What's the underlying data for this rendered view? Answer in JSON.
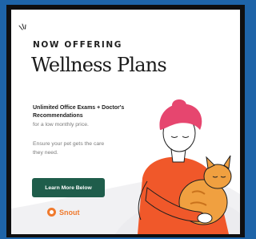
{
  "ad": {
    "kicker": "NOW OFFERING",
    "headline": "Wellness Plans",
    "subhead": "Unlimited Office Exams + Doctor's Recommendations",
    "price_note": "for a low monthly price.",
    "body": "Ensure your pet gets the care they need.",
    "cta_label": "Learn More Below",
    "brand_name": "Snout"
  },
  "colors": {
    "page_background": "#1e64a8",
    "frame": "#0f0f10",
    "card": "#ffffff",
    "cta_background": "#1f5d4b",
    "brand_orange": "#f07a2d",
    "hair_pink": "#e6466f",
    "sweater_orange": "#f0582a",
    "cat_orange": "#f0a040"
  },
  "icons": {
    "sparkle": "sparkle-icon",
    "brand": "snout-logo-icon"
  }
}
